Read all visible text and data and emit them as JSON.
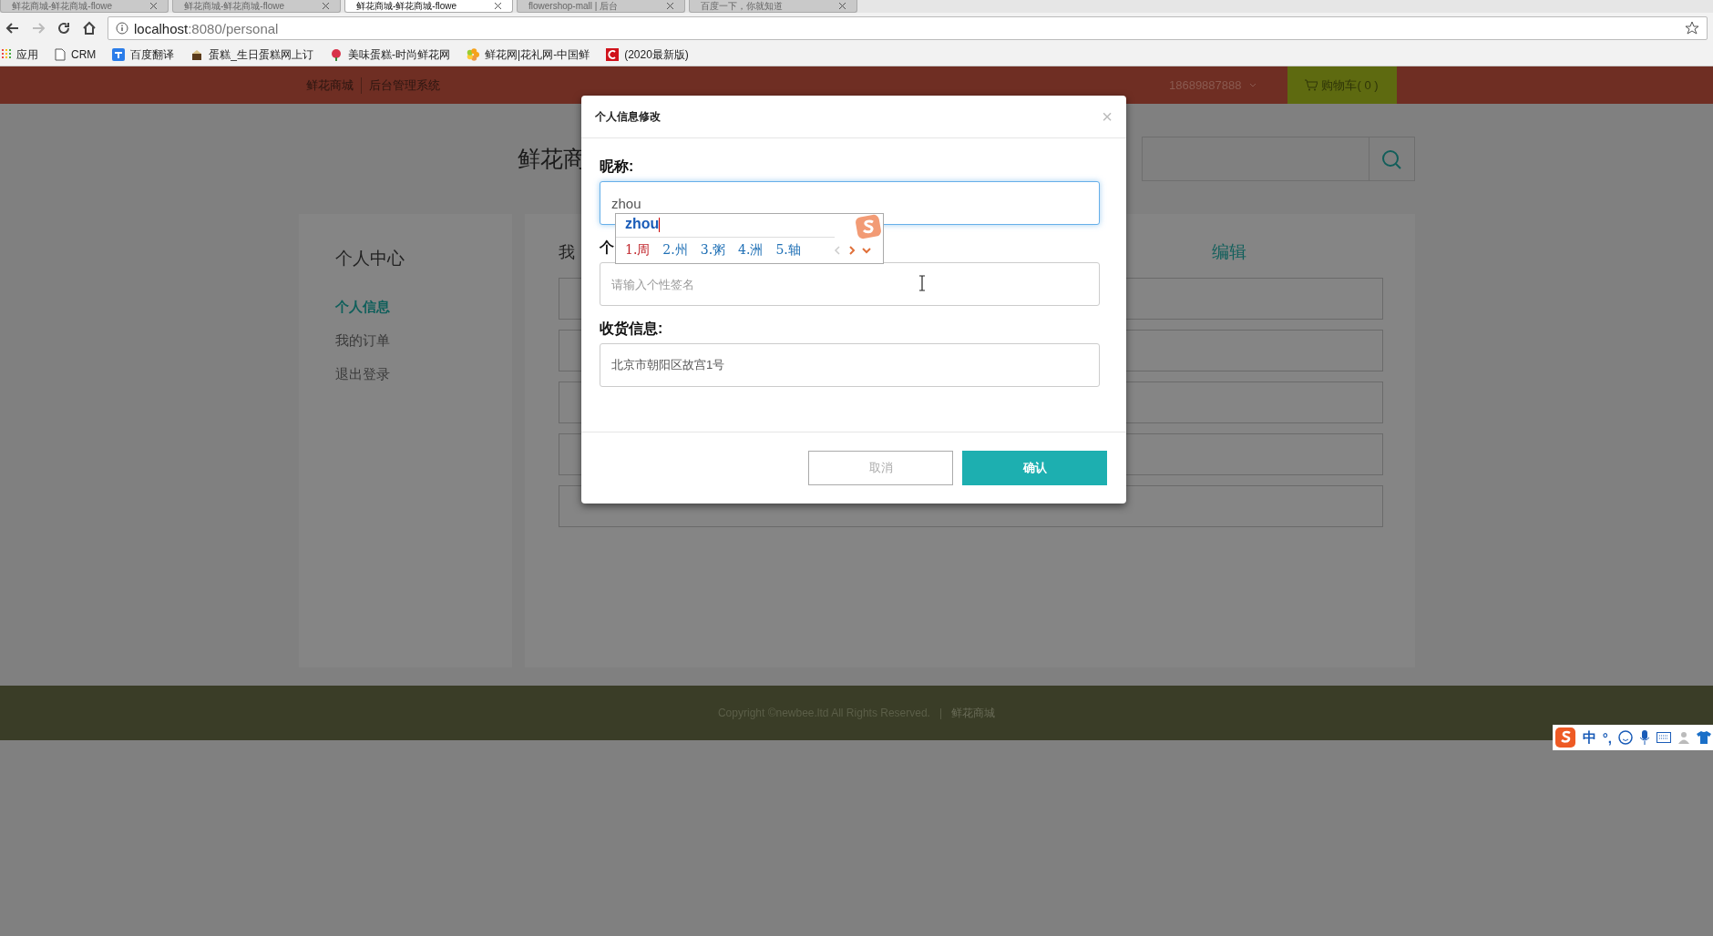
{
  "browser": {
    "tabs": [
      {
        "title": "鲜花商城-鲜花商城-flowe",
        "selected": false
      },
      {
        "title": "鲜花商城-鲜花商城-flowe",
        "selected": false
      },
      {
        "title": "鲜花商城-鲜花商城-flowe",
        "selected": true
      },
      {
        "title": "flowershop-mall | 后台",
        "selected": false
      },
      {
        "title": "百度一下，你就知道",
        "selected": false
      }
    ],
    "url_host": "localhost",
    "url_rest": ":8080/personal",
    "bookmarks": [
      {
        "label": "应用",
        "kind": "apps"
      },
      {
        "label": "CRM",
        "kind": "page"
      },
      {
        "label": "百度翻译",
        "kind": "translate"
      },
      {
        "label": "蛋糕_生日蛋糕网上订",
        "kind": "cake"
      },
      {
        "label": "美味蛋糕-时尚鲜花网",
        "kind": "rose"
      },
      {
        "label": "鲜花网|花礼网-中国鲜",
        "kind": "flower"
      },
      {
        "label": "(2020最新版)",
        "kind": "red"
      }
    ]
  },
  "header": {
    "links": [
      "鲜花商城",
      "后台管理系统"
    ],
    "account": "18689887888",
    "cart": "购物车( 0 )"
  },
  "page": {
    "logo": "鲜花商",
    "sidebar": {
      "title": "个人中心",
      "items": [
        {
          "label": "个人信息",
          "selected": true
        },
        {
          "label": "我的订单",
          "selected": false
        },
        {
          "label": "退出登录",
          "selected": false
        }
      ]
    },
    "main": {
      "heading": "我",
      "edit": "编辑"
    }
  },
  "modal": {
    "title": "个人信息修改",
    "close": "×",
    "fields": [
      {
        "label": "昵称:",
        "value": "zhou",
        "focused": true
      },
      {
        "label": "个",
        "placeholder": "请输入个性签名",
        "focused": false
      },
      {
        "label": "收货信息:",
        "value": "北京市朝阳区故宫1号",
        "focused": false
      }
    ],
    "buttons": [
      {
        "label": "取消",
        "kind": "cancel"
      },
      {
        "label": "确认",
        "kind": "confirm"
      }
    ]
  },
  "ime": {
    "composition": "zhou",
    "candidates": [
      {
        "label": "1.周",
        "selected": true
      },
      {
        "label": "2.州",
        "selected": false
      },
      {
        "label": "3.粥",
        "selected": false
      },
      {
        "label": "4.洲",
        "selected": false
      },
      {
        "label": "5.轴",
        "selected": false
      }
    ]
  },
  "ime_bar": {
    "mode": "中",
    "punct": "°,"
  },
  "footer": {
    "copyright": "Copyright ©newbee.ltd All Rights Reserved.",
    "separator": "|",
    "link": "鲜花商城"
  }
}
